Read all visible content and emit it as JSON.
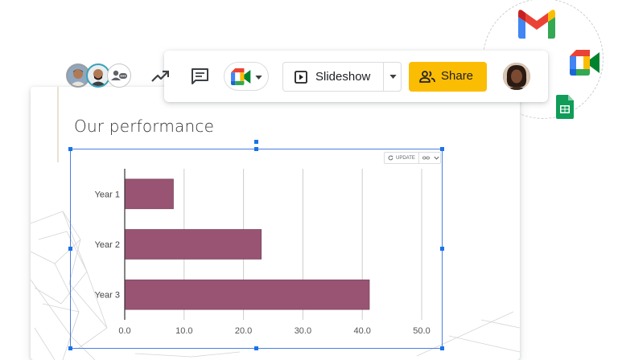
{
  "toolbar": {
    "slideshow_label": "Slideshow",
    "share_label": "Share"
  },
  "slide": {
    "title": "Our performance"
  },
  "chart_tools": {
    "update_label": "UPDATE"
  },
  "colors": {
    "bar": "#985472",
    "share": "#fbbc04",
    "selection": "#1a73e8"
  },
  "chart_data": {
    "type": "bar",
    "orientation": "horizontal",
    "categories": [
      "Year 1",
      "Year 2",
      "Year 3"
    ],
    "values": [
      8.2,
      23.0,
      41.2
    ],
    "xlim": [
      0,
      50
    ],
    "xticks": [
      "0.0",
      "10.0",
      "20.0",
      "30.0",
      "40.0",
      "50.0"
    ],
    "grid": true,
    "title": "",
    "xlabel": "",
    "ylabel": ""
  }
}
